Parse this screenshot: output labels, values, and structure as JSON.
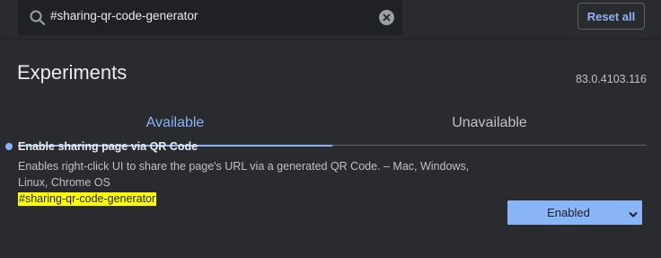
{
  "search": {
    "value": "#sharing-qr-code-generator",
    "icon": "search-icon",
    "clear_icon": "clear-icon"
  },
  "header": {
    "reset_label": "Reset all"
  },
  "page": {
    "title": "Experiments",
    "version": "83.0.4103.116"
  },
  "tabs": [
    {
      "label": "Available",
      "selected": true
    },
    {
      "label": "Unavailable",
      "selected": false
    }
  ],
  "experiment": {
    "title": "Enable sharing page via QR Code",
    "description": "Enables right-click UI to share the page's URL via a generated QR Code. – Mac, Windows, Linux, Chrome OS",
    "link": "#sharing-qr-code-generator",
    "state": "Enabled",
    "state_icon": "chevron-down-icon"
  },
  "colors": {
    "background": "#2a2b2e",
    "search_background": "#202124",
    "accent": "#8ab4f8",
    "highlight": "#ffff00"
  }
}
